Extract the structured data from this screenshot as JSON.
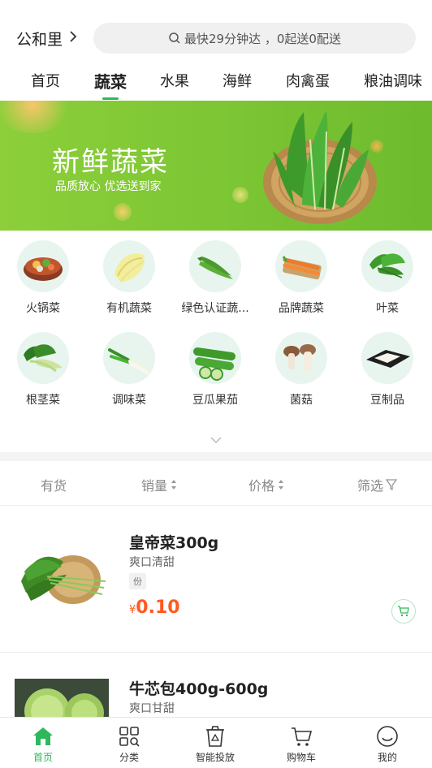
{
  "header": {
    "location": "公和里",
    "search_text": "最快29分钟达 ，0起送0配送"
  },
  "tabs": [
    {
      "label": "首页",
      "active": false
    },
    {
      "label": "蔬菜",
      "active": true
    },
    {
      "label": "水果",
      "active": false
    },
    {
      "label": "海鲜",
      "active": false
    },
    {
      "label": "肉禽蛋",
      "active": false
    },
    {
      "label": "粮油调味",
      "active": false
    }
  ],
  "banner": {
    "title": "新鲜蔬菜",
    "subtitle": "品质放心 优选送到家"
  },
  "categories": [
    {
      "label": "火锅菜",
      "icon": "hotpot-icon"
    },
    {
      "label": "有机蔬菜",
      "icon": "cabbage-icon"
    },
    {
      "label": "绿色认证蔬...",
      "icon": "okra-icon"
    },
    {
      "label": "品牌蔬菜",
      "icon": "carrot-icon"
    },
    {
      "label": "叶菜",
      "icon": "leafy-greens-icon"
    },
    {
      "label": "根茎菜",
      "icon": "bok-choy-icon"
    },
    {
      "label": "调味菜",
      "icon": "scallion-icon"
    },
    {
      "label": "豆瓜果茄",
      "icon": "cucumber-icon"
    },
    {
      "label": "菌菇",
      "icon": "mushroom-icon"
    },
    {
      "label": "豆制品",
      "icon": "tofu-icon"
    }
  ],
  "sortbar": {
    "in_stock": "有货",
    "sales": "销量",
    "price": "价格",
    "filter": "筛选"
  },
  "products": [
    {
      "name": "皇帝菜300g",
      "desc": "爽口清甜",
      "tag": "份",
      "currency": "¥",
      "price": "0.10"
    },
    {
      "name": "牛芯包400g-600g",
      "desc": "爽口甘甜"
    }
  ],
  "bottom_nav": [
    {
      "label": "首页",
      "icon": "home-icon",
      "active": true
    },
    {
      "label": "分类",
      "icon": "category-grid-icon",
      "active": false
    },
    {
      "label": "智能投放",
      "icon": "recycle-bin-icon",
      "active": false
    },
    {
      "label": "购物车",
      "icon": "cart-icon",
      "active": false
    },
    {
      "label": "我的",
      "icon": "profile-icon",
      "active": false
    }
  ],
  "colors": {
    "accent": "#2eb85c",
    "price": "#ff5a1f",
    "banner": "#7cc534"
  }
}
